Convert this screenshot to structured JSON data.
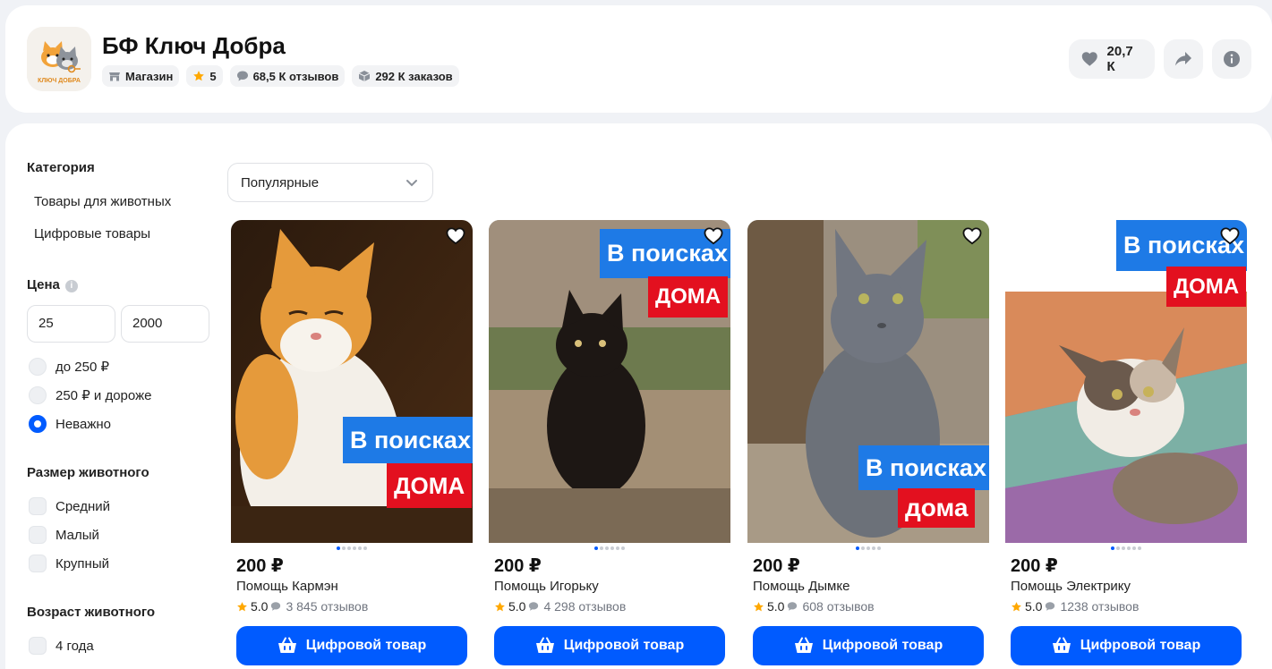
{
  "shop": {
    "name": "БФ Ключ Добра",
    "logo_text": "КЛЮЧ ДОБРА",
    "chips": {
      "store": "Магазин",
      "rating": "5",
      "reviews": "68,5 К отзывов",
      "orders": "292 К заказов"
    },
    "likes": "20,7 К"
  },
  "sidebar": {
    "category_title": "Категория",
    "categories": [
      "Товары для животных",
      "Цифровые товары"
    ],
    "price_title": "Цена",
    "price_info_icon": "i",
    "price_from": "25",
    "price_to": "2000",
    "price_options": [
      "до 250 ₽",
      "250 ₽ и дороже",
      "Неважно"
    ],
    "price_selected": "Неважно",
    "size_title": "Размер животного",
    "size_options": [
      "Средний",
      "Малый",
      "Крупный"
    ],
    "age_title": "Возраст животного",
    "age_options": [
      "4 года"
    ]
  },
  "sort": {
    "selected": "Популярные"
  },
  "banner": {
    "line1": "В поисках",
    "line2": "ДОМА",
    "line2_alt": "дома"
  },
  "products": [
    {
      "price": "200 ₽",
      "name": "Помощь Кармэн",
      "rating": "5.0",
      "reviews": "3 845 отзывов",
      "button": "Цифровой товар"
    },
    {
      "price": "200 ₽",
      "name": "Помощь Игорьку",
      "rating": "5.0",
      "reviews": "4 298 отзывов",
      "button": "Цифровой товар"
    },
    {
      "price": "200 ₽",
      "name": "Помощь Дымке",
      "rating": "5.0",
      "reviews": "608 отзывов",
      "button": "Цифровой товар"
    },
    {
      "price": "200 ₽",
      "name": "Помощь Электрику",
      "rating": "5.0",
      "reviews": "1238 отзывов",
      "button": "Цифровой товар"
    }
  ],
  "colors": {
    "accent": "#005bff",
    "banner_blue": "#1e7ae6",
    "banner_red": "#e3101f",
    "star": "#ffa800"
  },
  "icons": {
    "store": "store-icon",
    "star": "star-icon",
    "reviews": "chat-bubble-icon",
    "orders": "box-icon",
    "like": "heart-icon",
    "share": "share-arrow-icon",
    "info": "info-icon",
    "favorite": "heart-outline-icon",
    "cart": "basket-icon",
    "chevron": "chevron-down-icon"
  }
}
